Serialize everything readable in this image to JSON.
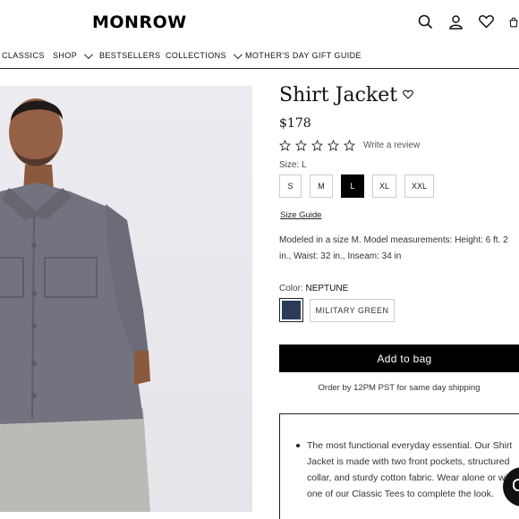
{
  "header": {
    "logo": "MONROW",
    "icons": [
      "search-icon",
      "account-icon",
      "wishlist-icon",
      "cart-icon"
    ]
  },
  "nav": {
    "items": [
      {
        "label": "CLASSICS",
        "has_dropdown": false
      },
      {
        "label": "SHOP",
        "has_dropdown": true
      },
      {
        "label": "BESTSELLERS",
        "has_dropdown": false
      },
      {
        "label": "COLLECTIONS",
        "has_dropdown": true
      },
      {
        "label": "MOTHER'S DAY GIFT GUIDE",
        "has_dropdown": false
      }
    ]
  },
  "product": {
    "title": "Shirt Jacket",
    "price": "$178",
    "rating_stars": 5,
    "write_review": "Write a review",
    "size_label": "Size: L",
    "sizes": [
      "S",
      "M",
      "L",
      "XL",
      "XXL"
    ],
    "selected_size": "L",
    "size_guide": "Size Guide",
    "model_line1": "Modeled in a size M. Model measurements: Height: 6 ft. 2",
    "model_line2": "in., Waist: 32 in., Inseam: 34 in",
    "color_label": "Color:",
    "color_value": "NEPTUNE",
    "swatch_color": "#2b3a58",
    "other_color": "MILITARY GREEN",
    "add_to_bag": "Add to bag",
    "shipping_note": "Order by 12PM PST for same day shipping",
    "description": "The most functional everyday essential. Our Shirt Jacket is made with two front pockets, structured collar, and sturdy cotton fabric. Wear alone or with one of our Classic Tees to complete the look."
  }
}
